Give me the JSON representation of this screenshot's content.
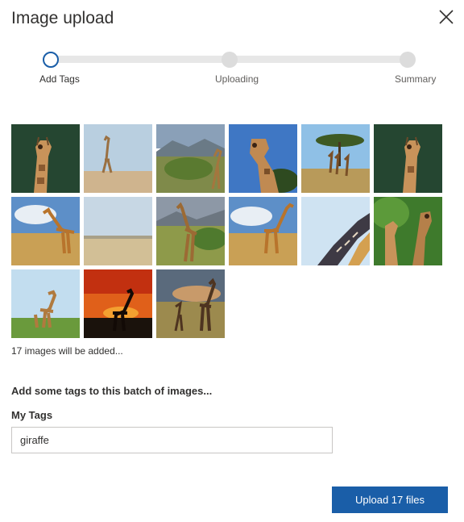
{
  "dialog": {
    "title": "Image upload"
  },
  "stepper": {
    "current_step": 1,
    "steps": [
      {
        "label": "Add Tags"
      },
      {
        "label": "Uploading"
      },
      {
        "label": "Summary"
      }
    ]
  },
  "images": {
    "thumbnails": [
      {
        "subject": "giraffe portrait, dark green background"
      },
      {
        "subject": "lone giraffe on savanna"
      },
      {
        "subject": "giraffe in bushland with mountains"
      },
      {
        "subject": "giraffe looking down, blue sky"
      },
      {
        "subject": "giraffes under acacia tree"
      },
      {
        "subject": "giraffe portrait, dark green background"
      },
      {
        "subject": "giraffe on grassland, cloudy sky"
      },
      {
        "subject": "empty savanna plain"
      },
      {
        "subject": "giraffe among green bushes"
      },
      {
        "subject": "giraffe on grassland, cloudy sky"
      },
      {
        "subject": "giraffe necks close-up, pale sky"
      },
      {
        "subject": "two giraffes among green leaves"
      },
      {
        "subject": "giraffes on green grass"
      },
      {
        "subject": "giraffe silhouette at sunset"
      },
      {
        "subject": "giraffes at dusk"
      }
    ],
    "count_text": "17 images will be added..."
  },
  "tags": {
    "section_title": "Add some tags to this batch of images...",
    "field_label": "My Tags",
    "value": "giraffe"
  },
  "actions": {
    "upload_label": "Upload 17 files"
  },
  "colors": {
    "accent": "#1a5ea8",
    "track": "#e7e7e7",
    "inactive_dot": "#dcdcdc"
  }
}
